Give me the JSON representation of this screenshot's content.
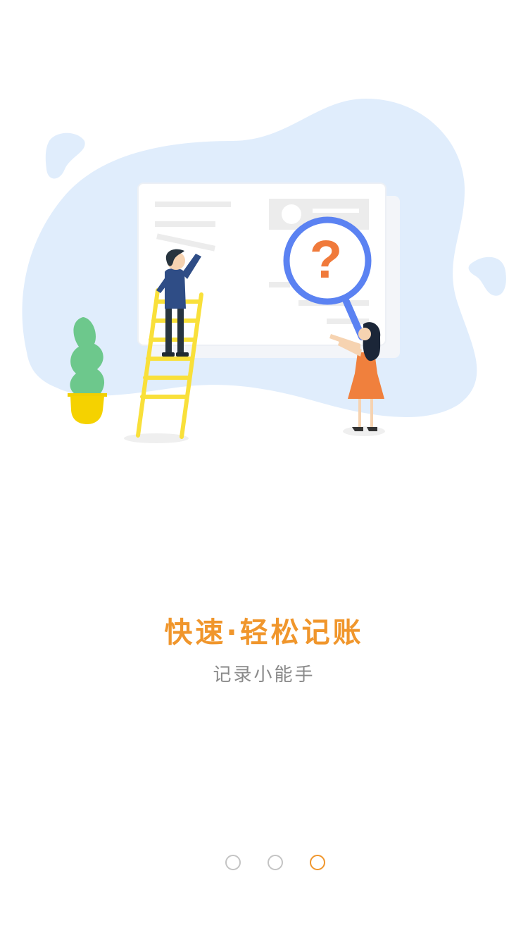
{
  "onboarding": {
    "title": "快速·轻松记账",
    "subtitle": "记录小能手",
    "page_indicator": {
      "total": 3,
      "active_index": 2
    }
  },
  "colors": {
    "accent": "#f0962c",
    "subtitle_text": "#8a8a8a",
    "inactive_dot": "#c4c4c4",
    "blob": "#e0edfc",
    "magnifier_ring": "#5b82f2",
    "question_mark": "#f07a3b"
  },
  "icons": {
    "question_mark_glyph": "?"
  }
}
